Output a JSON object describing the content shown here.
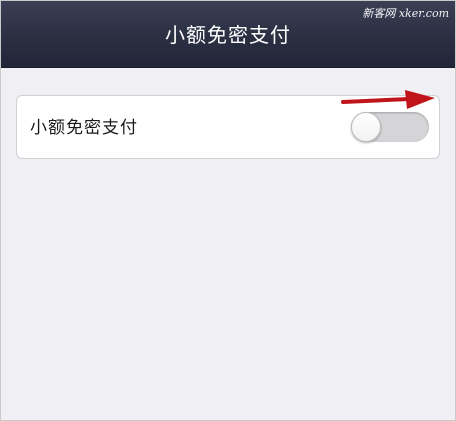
{
  "nav": {
    "title": "小额免密支付",
    "watermark": "新客网 xker.com"
  },
  "settings": {
    "row_label": "小额免密支付",
    "toggle_state": "off"
  },
  "colors": {
    "nav_background": "#2b2f42",
    "page_background": "#efeff4",
    "annotation_arrow": "#c0141a"
  },
  "icons": {
    "annotation": "red-arrow-icon"
  }
}
